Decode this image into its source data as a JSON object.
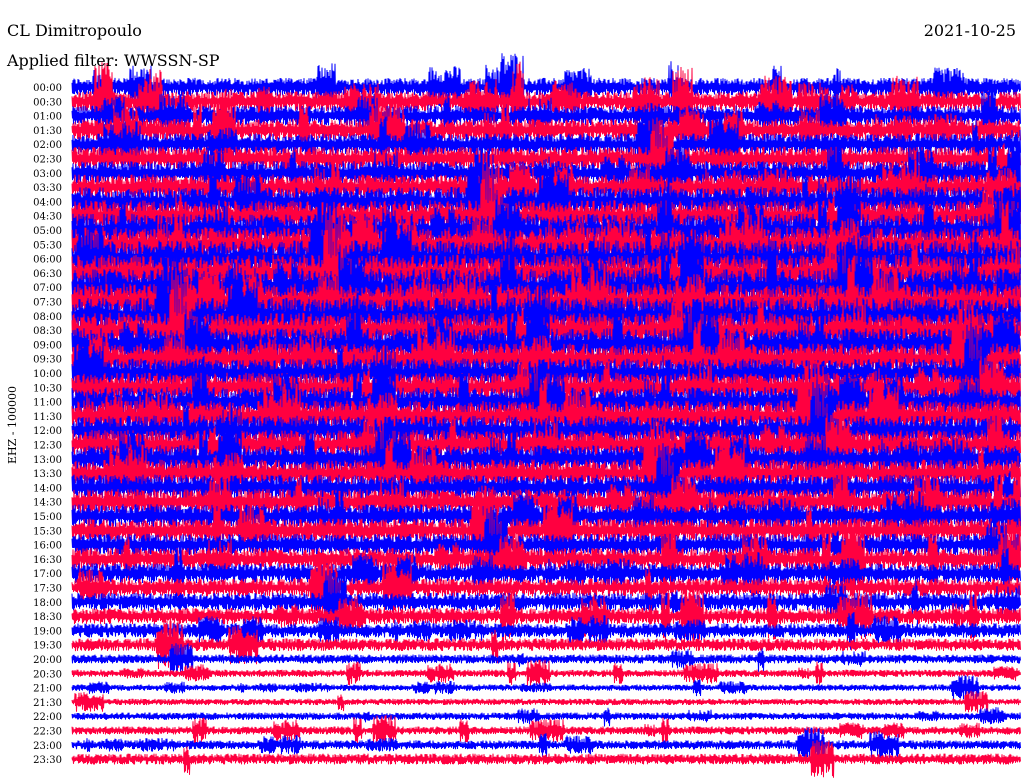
{
  "header": {
    "station": "CL Dimitropoulo",
    "date": "2021-10-25",
    "filter": "Applied filter: WWSSN-SP"
  },
  "chart_data": {
    "type": "line",
    "title": "CL Dimitropoulo",
    "subtitle": "Applied filter: WWSSN-SP",
    "ylabel": "EHZ - 100000",
    "row_labels": [
      "00:00",
      "00:30",
      "01:00",
      "01:30",
      "02:00",
      "02:30",
      "03:00",
      "03:30",
      "04:00",
      "04:30",
      "05:00",
      "05:30",
      "06:00",
      "06:30",
      "07:00",
      "07:30",
      "08:00",
      "08:30",
      "09:00",
      "09:30",
      "10:00",
      "10:30",
      "11:00",
      "11:30",
      "12:00",
      "12:30",
      "13:00",
      "13:30",
      "14:00",
      "14:30",
      "15:00",
      "15:30",
      "16:00",
      "16:30",
      "17:00",
      "17:30",
      "18:00",
      "18:30",
      "19:00",
      "19:30",
      "20:00",
      "20:30",
      "21:00",
      "21:30",
      "22:00",
      "22:30",
      "23:00",
      "23:30"
    ],
    "row_minutes": 30,
    "series_colors": [
      "#0000ff",
      "#ff0040"
    ],
    "relative_amplitude": [
      1.0,
      1.1,
      1.1,
      1.2,
      1.2,
      1.3,
      1.3,
      1.4,
      1.6,
      1.7,
      1.8,
      1.9,
      2.0,
      2.0,
      2.1,
      2.0,
      2.0,
      1.9,
      1.8,
      1.7,
      1.6,
      1.6,
      1.6,
      1.7,
      1.6,
      1.6,
      1.5,
      1.5,
      1.4,
      1.4,
      1.3,
      1.3,
      1.2,
      1.2,
      1.1,
      1.0,
      1.0,
      0.9,
      0.8,
      0.7,
      0.5,
      0.4,
      0.35,
      0.35,
      0.4,
      0.45,
      0.5,
      0.6
    ],
    "grid": false
  }
}
